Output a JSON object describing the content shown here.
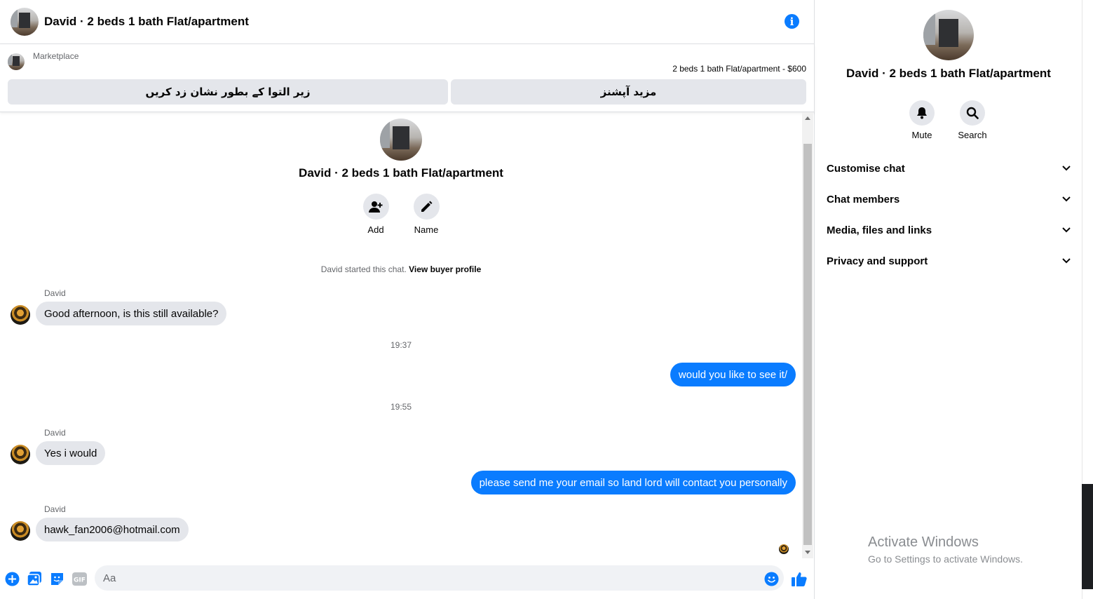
{
  "header": {
    "title": "David · 2 beds 1 bath Flat/apartment",
    "info_icon": "info-icon"
  },
  "marketplace": {
    "label": "Marketplace",
    "listing": "2 beds 1 bath Flat/apartment - $600",
    "mark_pending_label": "زیر التوا کے بطور نشان زد کریں",
    "more_options_label": "مزید آپشنز"
  },
  "thread": {
    "title": "David · 2 beds 1 bath Flat/apartment",
    "add_label": "Add",
    "name_label": "Name",
    "started_text": "David started this chat.",
    "view_profile_label": "View buyer profile",
    "messages": [
      {
        "sender": "David",
        "text": "Good afternoon, is this still available?"
      },
      {
        "time": "19:37"
      },
      {
        "text": "would you like to see it/"
      },
      {
        "time": "19:55"
      },
      {
        "sender": "David",
        "text": "Yes i would"
      },
      {
        "text": "please send me your email so land lord will contact you personally"
      },
      {
        "sender": "David",
        "text": "hawk_fan2006@hotmail.com"
      }
    ]
  },
  "composer": {
    "placeholder": "Aa"
  },
  "panel": {
    "title": "David · 2 beds 1 bath Flat/apartment",
    "mute_label": "Mute",
    "search_label": "Search",
    "sections": [
      "Customise chat",
      "Chat members",
      "Media, files and links",
      "Privacy and support"
    ]
  },
  "watermark": {
    "line1": "Activate Windows",
    "line2": "Go to Settings to activate Windows."
  },
  "colors": {
    "accent": "#0a7cff",
    "bubble_in": "#e4e6eb",
    "secondary_text": "#65676b"
  }
}
